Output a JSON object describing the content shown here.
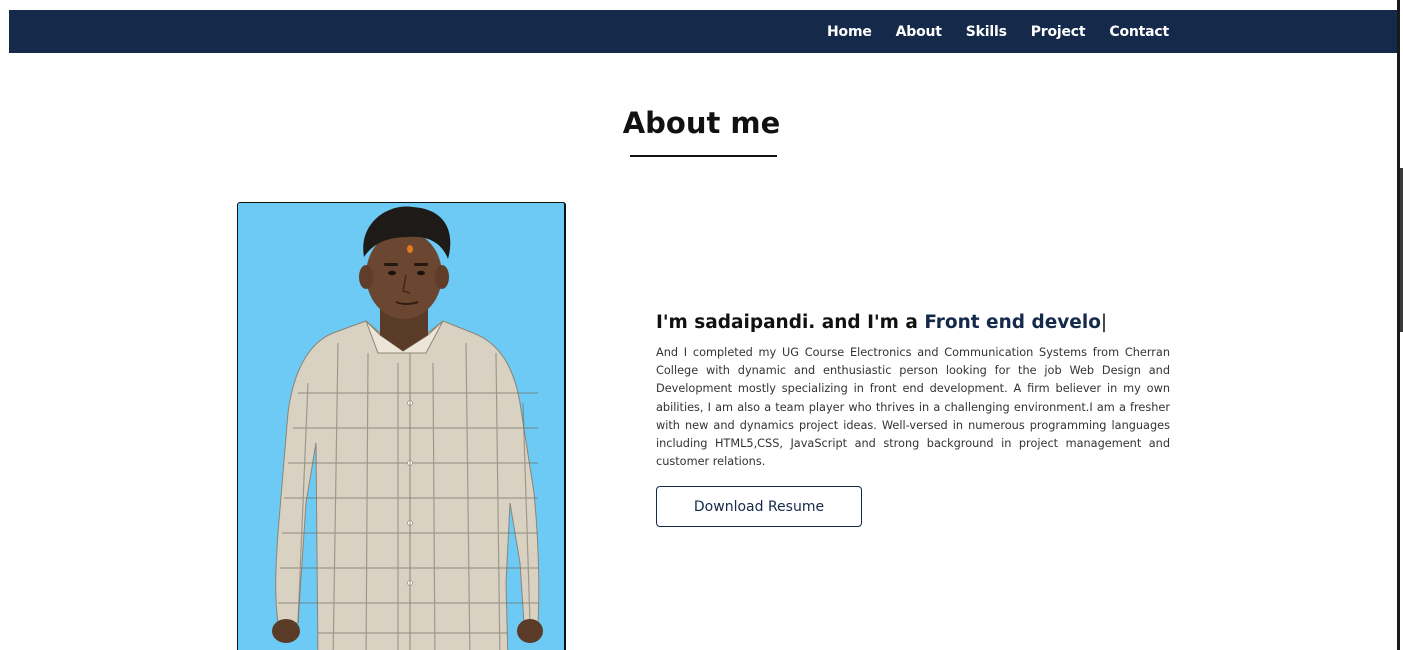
{
  "nav": {
    "items": [
      {
        "label": "Home"
      },
      {
        "label": "About"
      },
      {
        "label": "Skills"
      },
      {
        "label": "Project"
      },
      {
        "label": "Contact"
      }
    ]
  },
  "about": {
    "title": "About me",
    "headline_prefix": "I'm sadaipandi. and I'm a ",
    "headline_typed": "Front end develo",
    "headline_cursor": "|",
    "description": "And I completed my UG Course Electronics and Communication Systems from Cherran College with dynamic and enthusiastic person looking for the job Web Design and Development mostly specializing in front end development. A firm believer in my own abilities, I am also a team player who thrives in a challenging environment.I am a fresher with new and dynamics project ideas. Well-versed in numerous programming languages including HTML5,CSS, JavaScript and strong background in project management and customer relations.",
    "resume_button": "Download Resume"
  },
  "colors": {
    "navbar": "#15294a",
    "photo_background": "#6ccaf5",
    "accent": "#15294a"
  }
}
